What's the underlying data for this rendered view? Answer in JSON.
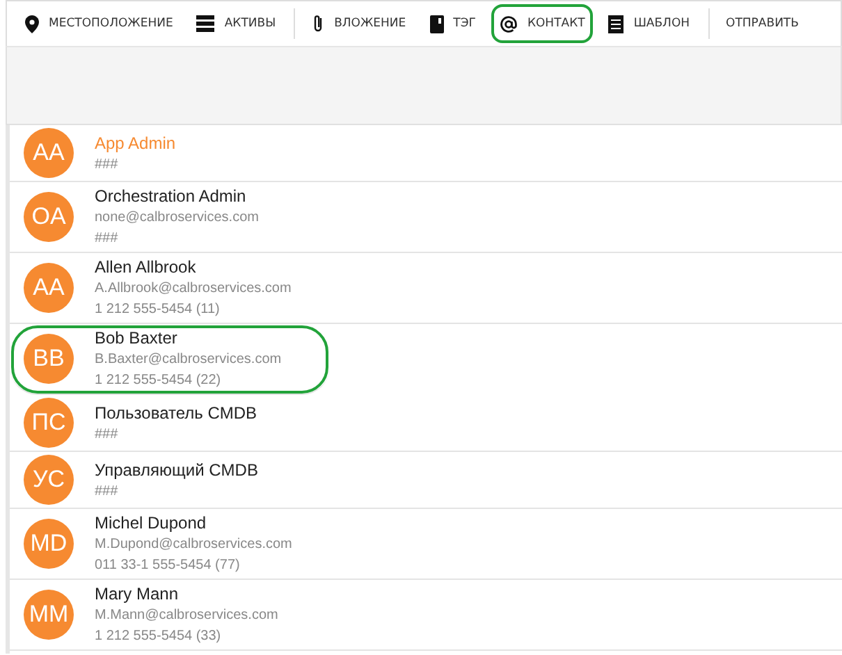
{
  "toolbar": [
    {
      "kind": "pin",
      "label": "МЕСТОПОЛОЖЕНИЕ",
      "highlighted": false,
      "divider_after": false
    },
    {
      "kind": "server",
      "label": "АКТИВЫ",
      "highlighted": false,
      "divider_after": true
    },
    {
      "kind": "clip",
      "label": "ВЛОЖЕНИЕ",
      "highlighted": false,
      "divider_after": false
    },
    {
      "kind": "tag",
      "label": "ТЭГ",
      "highlighted": false,
      "divider_after": false
    },
    {
      "kind": "at",
      "label": "КОНТАКТ",
      "highlighted": true,
      "divider_after": false
    },
    {
      "kind": "doc",
      "label": "ШАБЛОН",
      "highlighted": false,
      "divider_after": true
    },
    {
      "kind": "none",
      "label": "ОТПРАВИТЬ",
      "highlighted": false,
      "divider_after": false
    }
  ],
  "contacts": [
    {
      "initials": "AA",
      "name": "App Admin",
      "lines": [
        "###"
      ],
      "selected": true,
      "highlighted": false
    },
    {
      "initials": "OA",
      "name": "Orchestration Admin",
      "lines": [
        "none@calbroservices.com",
        "###"
      ],
      "selected": false,
      "highlighted": false
    },
    {
      "initials": "AA",
      "name": "Allen Allbrook",
      "lines": [
        "A.Allbrook@calbroservices.com",
        "1 212 555-5454 (11)"
      ],
      "selected": false,
      "highlighted": false
    },
    {
      "initials": "BB",
      "name": "Bob Baxter",
      "lines": [
        "B.Baxter@calbroservices.com",
        "1 212 555-5454 (22)"
      ],
      "selected": false,
      "highlighted": true
    },
    {
      "initials": "ПС",
      "name": "Пользователь CMDB",
      "lines": [
        "###"
      ],
      "selected": false,
      "highlighted": false
    },
    {
      "initials": "УС",
      "name": "Управляющий CMDB",
      "lines": [
        "###"
      ],
      "selected": false,
      "highlighted": false
    },
    {
      "initials": "MD",
      "name": "Michel Dupond",
      "lines": [
        "M.Dupond@calbroservices.com",
        "011 33-1 555-5454 (77)"
      ],
      "selected": false,
      "highlighted": false
    },
    {
      "initials": "MM",
      "name": "Mary Mann",
      "lines": [
        "M.Mann@calbroservices.com",
        "1 212 555-5454 (33)"
      ],
      "selected": false,
      "highlighted": false
    }
  ]
}
